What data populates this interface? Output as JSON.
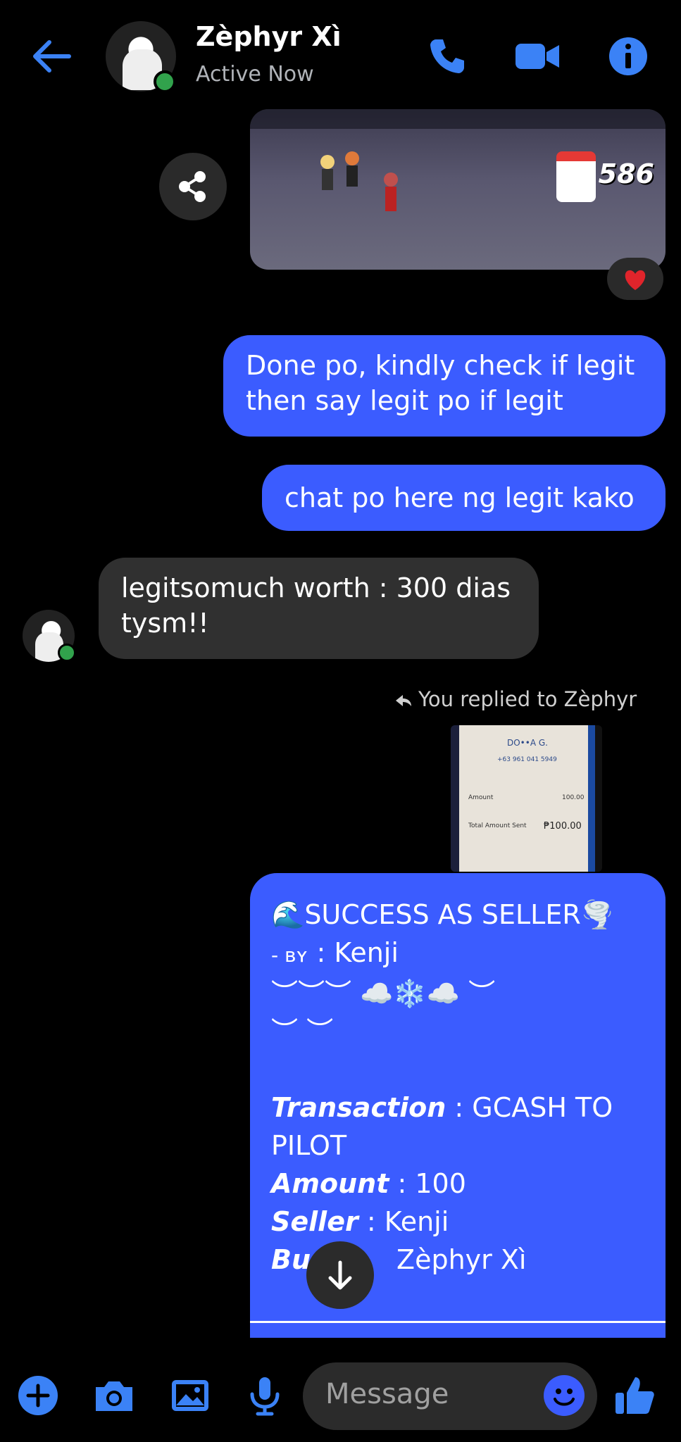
{
  "header": {
    "title": "Zèphyr Xì",
    "status": "Active Now"
  },
  "shared_image": {
    "score": "586"
  },
  "messages": {
    "m1": "Done po, kindly check if legit then say legit po if legit",
    "m2": "chat po here ng legit kako",
    "m3": "legitsomuch worth : 300 dias tysm!!",
    "reply_note": "You replied to Zèphyr"
  },
  "quoted_receipt": {
    "name": "DO••A G.",
    "number": "+63 961 041 5949",
    "amount_label": "Amount",
    "amount_value": "100.00",
    "total_label": "Total Amount Sent",
    "total_value": "₱100.00"
  },
  "big_message": {
    "headline": "🌊SUCCESS AS SELLER🌪️",
    "by_prefix": "- ʙʏ",
    "by_value": ": Kenji",
    "deco1": "︶︶︶ ☁️❄️☁️ ︶",
    "deco2": "︶ ︶",
    "transaction_label": "Transaction",
    "transaction_value": ": GCASH TO",
    "transaction_value2": "PILOT",
    "amount_label": "Amount",
    "amount_value": ": 100",
    "seller_label": "Seller",
    "seller_value": ": Kenji",
    "buyer_label": "Bu",
    "buyer_value": "Zèphyr Xì"
  },
  "composer": {
    "placeholder": "Message"
  },
  "colors": {
    "accent": "#3b5cff",
    "online": "#31a24c",
    "received_bubble": "#303030"
  }
}
